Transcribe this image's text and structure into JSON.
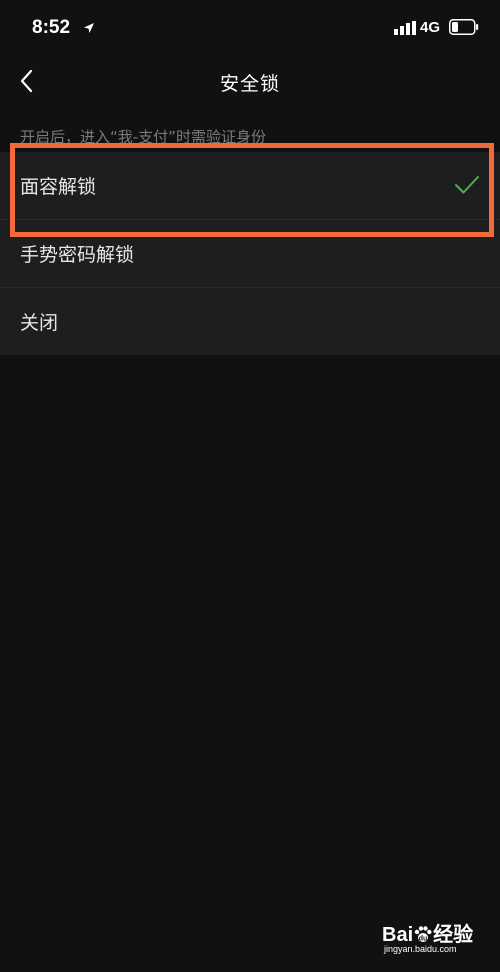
{
  "status_bar": {
    "time": "8:52",
    "network": "4G",
    "icons": [
      "location-arrow-icon",
      "cellular-signal-icon",
      "battery-icon"
    ]
  },
  "nav": {
    "title": "安全锁",
    "back_icon": "chevron-left-icon"
  },
  "section_hint": "开启后，进入“我-支付”时需验证身份",
  "options": [
    {
      "label": "面容解锁",
      "selected": true
    },
    {
      "label": "手势密码解锁",
      "selected": false
    },
    {
      "label": "关闭",
      "selected": false
    }
  ],
  "colors": {
    "background": "#111111",
    "list_background": "#1e1e1e",
    "check_green": "#4caf50",
    "highlight_orange": "#f26a3b"
  },
  "watermark": {
    "logo_text_left": "Bai",
    "logo_text_right": "经验",
    "url": "jingyan.baidu.com"
  }
}
